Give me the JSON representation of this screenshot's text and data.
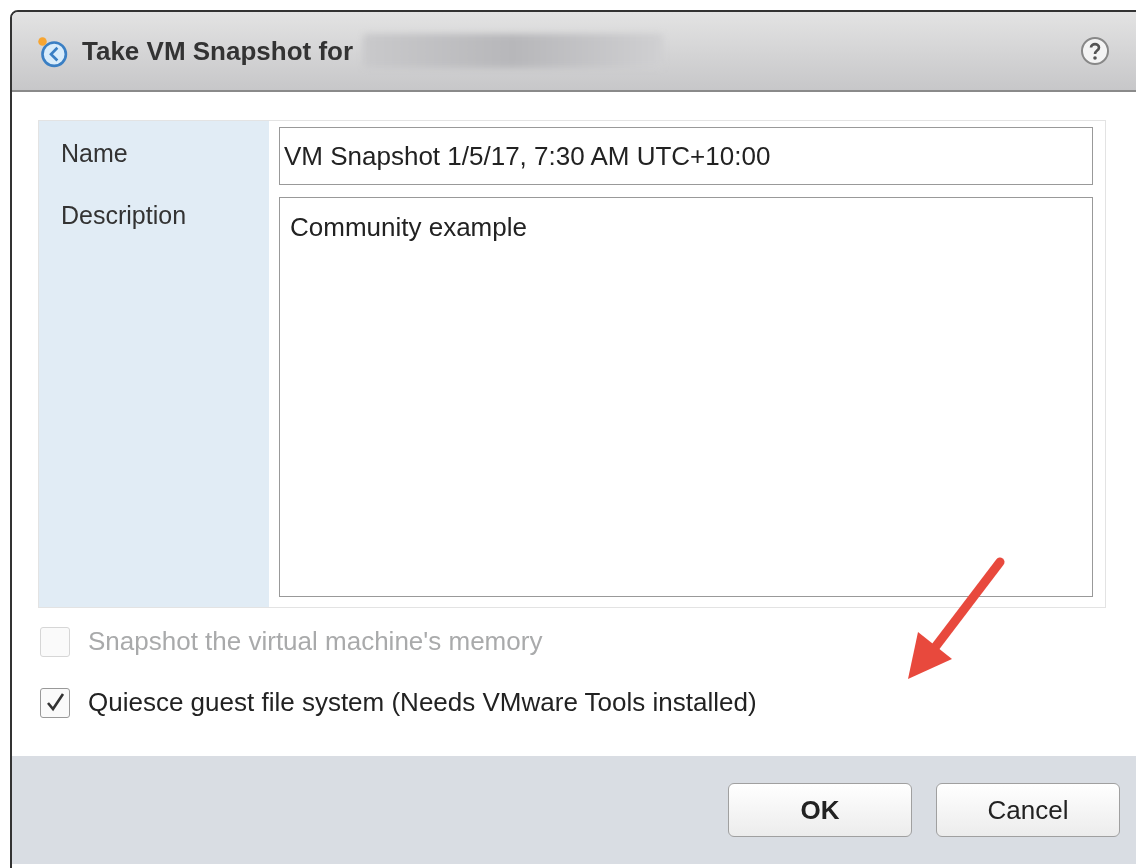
{
  "dialog": {
    "title": "Take VM Snapshot for",
    "title_redacted": true
  },
  "form": {
    "fields": [
      {
        "kind": "line",
        "label": "Name",
        "value": "VM Snapshot 1/5/17, 7:30 AM UTC+10:00"
      },
      {
        "kind": "area",
        "label": "Description",
        "value": "Community example"
      }
    ]
  },
  "options": [
    {
      "label": "Snapshot the virtual machine's memory",
      "checked": false,
      "disabled": true
    },
    {
      "label": "Quiesce guest file system (Needs VMware Tools installed)",
      "checked": true,
      "disabled": false
    }
  ],
  "buttons": [
    {
      "label": "OK",
      "kind": "primary"
    },
    {
      "label": "Cancel",
      "kind": "secondary"
    }
  ],
  "annotation_arrow": true
}
